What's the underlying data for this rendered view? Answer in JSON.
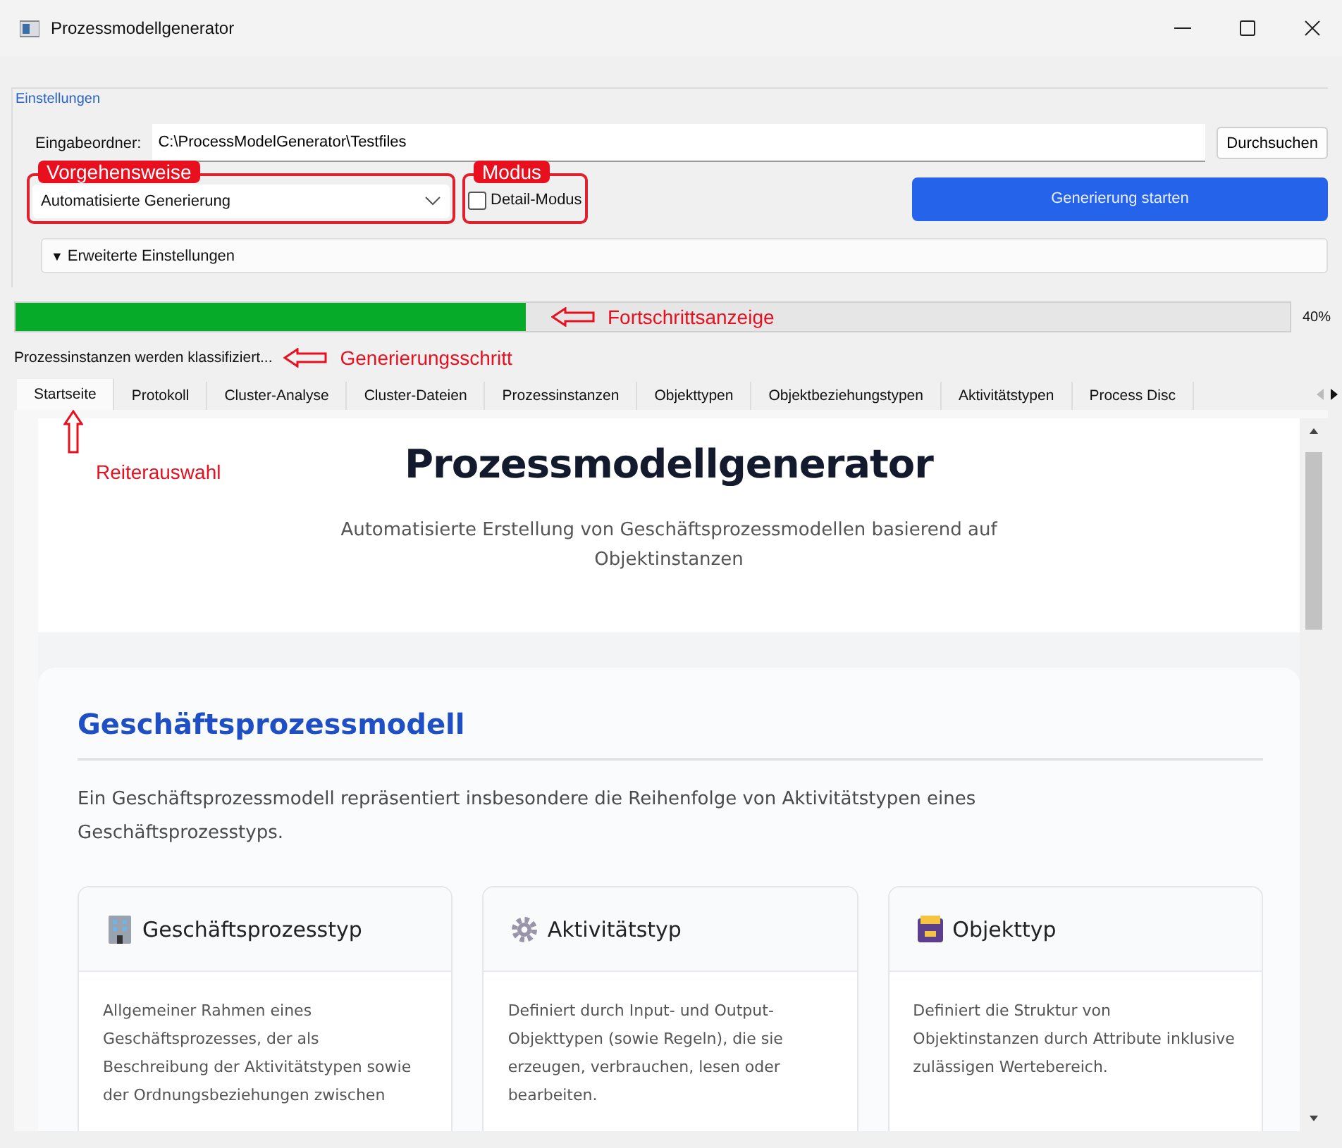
{
  "window": {
    "title": "Prozessmodellgenerator"
  },
  "settings": {
    "group_title": "Einstellungen",
    "folder_label": "Eingabeordner:",
    "folder_value": "C:\\ProcessModelGenerator\\Testfiles",
    "browse_button": "Durchsuchen",
    "approach": {
      "annotation": "Vorgehensweise",
      "value": "Automatisierte Generierung"
    },
    "detail_mode": {
      "annotation": "Modus",
      "label": "Detail-Modus",
      "checked": false
    },
    "start_button": "Generierung starten",
    "advanced": {
      "marker": "▼",
      "label": "Erweiterte Einstellungen"
    }
  },
  "progress": {
    "level": 0.4,
    "reading": "40%",
    "annotation": "Fortschrittsanzeige"
  },
  "status": {
    "text": "Prozessinstanzen werden klassifiziert...",
    "annotation": "Generierungsschritt"
  },
  "tabs_annotation": "Reiterauswahl",
  "tabs": [
    {
      "label": "Startseite",
      "selected": true
    },
    {
      "label": "Protokoll",
      "selected": false
    },
    {
      "label": "Cluster-Analyse",
      "selected": false
    },
    {
      "label": "Cluster-Dateien",
      "selected": false
    },
    {
      "label": "Prozessinstanzen",
      "selected": false
    },
    {
      "label": "Objekttypen",
      "selected": false
    },
    {
      "label": "Objektbeziehungstypen",
      "selected": false
    },
    {
      "label": "Aktivitätstypen",
      "selected": false
    },
    {
      "label": "Process Disc",
      "selected": false
    }
  ],
  "page": {
    "title": "Prozessmodellgenerator",
    "subtitle": "Automatisierte Erstellung von Geschäftsprozessmodellen basierend auf Objektinstanzen",
    "section": {
      "heading": "Geschäftsprozessmodell",
      "text": "Ein Geschäftsprozessmodell repräsentiert insbesondere die Reihenfolge von Aktivitätstypen eines Geschäftsprozesstyps.",
      "cards": [
        {
          "kind": "building",
          "title": "Geschäftsprozesstyp",
          "text": "Allgemeiner Rahmen eines Geschäftsprozesses, der als Beschreibung der Aktivitätstypen sowie der Ordnungsbeziehungen zwischen"
        },
        {
          "kind": "gear",
          "title": "Aktivitätstyp",
          "text": "Definiert durch Input- und Output-Objekttypen (sowie Regeln), die sie erzeugen, verbrauchen, lesen oder bearbeiten."
        },
        {
          "kind": "box",
          "title": "Objekttyp",
          "text": "Definiert die Struktur von Objektinstanzen durch Attribute inklusive zulässigen Wertebereich."
        }
      ]
    }
  }
}
